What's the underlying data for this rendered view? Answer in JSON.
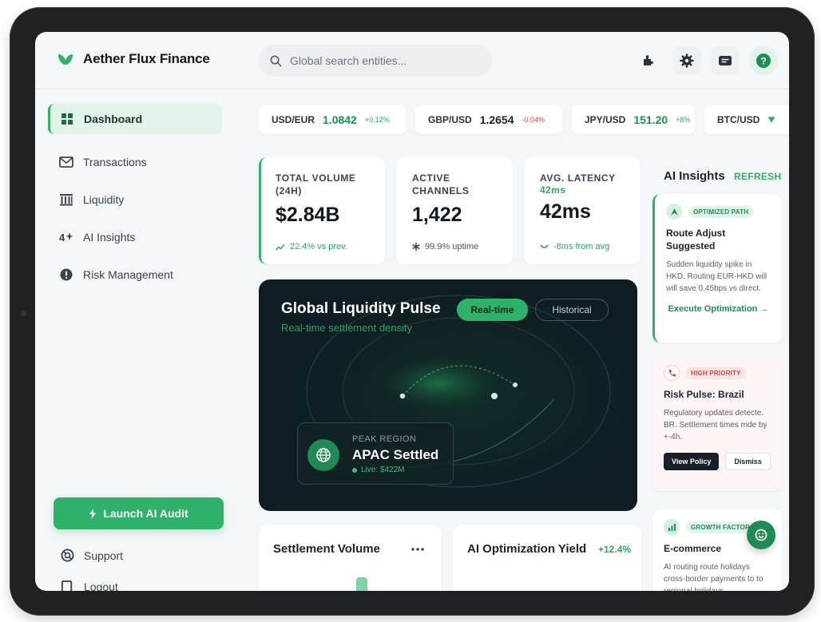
{
  "brand": {
    "name": "Aether Flux Finance"
  },
  "search": {
    "placeholder": "Global search entities..."
  },
  "sidebar": {
    "items": [
      {
        "label": "Dashboard",
        "icon": "grid-icon",
        "active": true
      },
      {
        "label": "Transactions",
        "icon": "envelope-icon"
      },
      {
        "label": "Liquidity",
        "icon": "bank-icon"
      },
      {
        "label": "AI Insights",
        "icon": "sparkle-icon"
      },
      {
        "label": "Risk Management",
        "icon": "alert-icon"
      }
    ],
    "launch": {
      "label": "Launch AI Audit"
    },
    "footer": [
      {
        "label": "Support",
        "icon": "support-icon"
      },
      {
        "label": "Logout",
        "icon": "logout-icon"
      }
    ]
  },
  "tickers": [
    {
      "pair": "USD/EUR",
      "price": "1.0842",
      "change": "+0.12%",
      "trend": "up"
    },
    {
      "pair": "GBP/USD",
      "price": "1.2654",
      "change": "-0.04%",
      "trend": "down"
    },
    {
      "pair": "JPY/USD",
      "price": "151.20",
      "change": "+8%",
      "trend": "up"
    },
    {
      "pair": "BTC/USD",
      "price": "",
      "change": "",
      "trend": "down"
    }
  ],
  "stats": [
    {
      "label": "TOTAL VOLUME (24H)",
      "value": "$2.84B",
      "trend": "22.4% vs prev."
    },
    {
      "label": "ACTIVE CHANNELS",
      "value": "1,422",
      "trend": "99.9% uptime"
    },
    {
      "label": "AVG. LATENCY",
      "sublabel": "42ms",
      "value": "42ms",
      "trend": "-8ms from avg"
    }
  ],
  "pulse": {
    "title": "Global Liquidity Pulse",
    "subtitle": "Real-time settlement density",
    "toggle_on": "Real-time",
    "toggle_off": "Historical",
    "peak_label": "PEAK REGION",
    "peak_name": "APAC Settled",
    "peak_live": "Live: $422M"
  },
  "bottom": {
    "settlement_title": "Settlement Volume",
    "optimization_title": "AI Optimization Yield",
    "optimization_change": "+12.4%"
  },
  "insights": {
    "title": "AI Insights",
    "refresh": "REFRESH",
    "cards": [
      {
        "badge": "OPTIMIZED PATH",
        "title": "Route Adjust Suggested",
        "body": "Sudden liquidity spike in HKD. Routing EUR-HKD will will save 0.45bps vs direct.",
        "link": "Execute Optimization →"
      },
      {
        "badge": "HIGH PRIORITY",
        "title": "Risk Pulse: Brazil",
        "body": "Regulatory updates detecte. BR. Settlement times mde by +-4h.",
        "primary": "View Policy",
        "secondary": "Dismiss"
      },
      {
        "badge": "GROWTH FACTOR",
        "title": "E-commerce",
        "body": "AI routing route holidays cross-border payments to to regional holidays."
      }
    ]
  },
  "colors": {
    "accent": "#2eb26a",
    "dark_panel": "#0f1c22",
    "danger": "#d94545"
  }
}
